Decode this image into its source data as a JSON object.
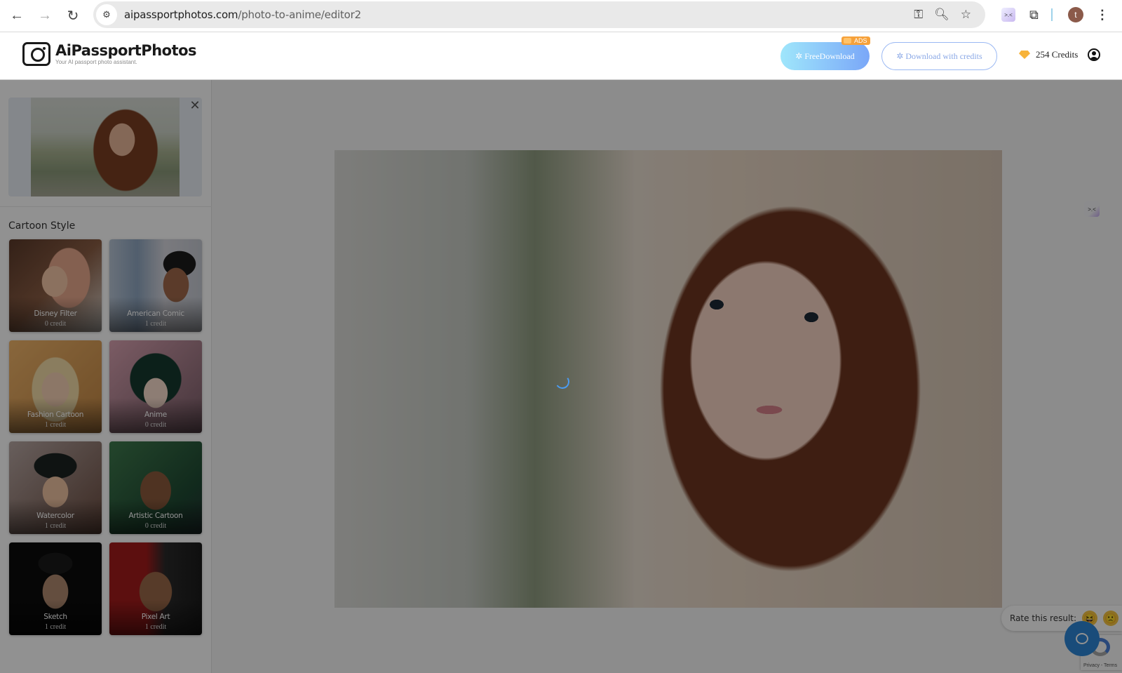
{
  "browser": {
    "url_domain": "aipassportphotos.com",
    "url_path": "/photo-to-anime/editor2",
    "profile_initial": "t",
    "icons": [
      "back-icon",
      "forward-icon",
      "reload-icon",
      "site-info-icon",
      "password-key-icon",
      "zoom-icon",
      "bookmark-star-icon",
      "extension-icon",
      "extensions-puzzle-icon",
      "profile-avatar",
      "menu-kebab-icon"
    ]
  },
  "header": {
    "logo_title": "AiPassportPhotos",
    "logo_subtitle": "Your AI passport photo assistant.",
    "free_download_label": "FreeDownload",
    "ads_badge": "ADS",
    "download_credits_label": "Download with credits",
    "credits_text": "254 Credits"
  },
  "sidebar": {
    "section_title": "Cartoon Style",
    "styles": [
      {
        "name": "Disney Filter",
        "cost": "0 credit"
      },
      {
        "name": "American Comic",
        "cost": "1 credit"
      },
      {
        "name": "Fashion Cartoon",
        "cost": "1 credit"
      },
      {
        "name": "Anime",
        "cost": "0 credit"
      },
      {
        "name": "Watercolor",
        "cost": "1 credit"
      },
      {
        "name": "Artistic Cartoon",
        "cost": "0 credit"
      },
      {
        "name": "Sketch",
        "cost": "1 credit"
      },
      {
        "name": "Pixel Art",
        "cost": "1 credit"
      }
    ]
  },
  "main": {
    "state": "loading",
    "rate_label": "Rate this result:",
    "rate_options": [
      "😆",
      "🙁"
    ],
    "recaptcha_terms": "Privacy - Terms"
  }
}
